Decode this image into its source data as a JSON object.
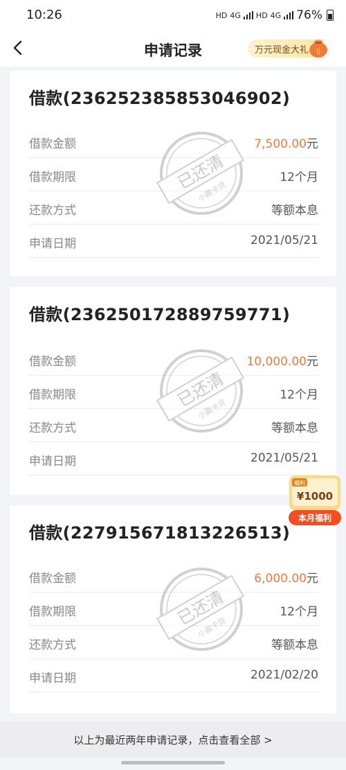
{
  "status": {
    "time": "10:26",
    "net1": "HD",
    "net2": "4G",
    "net3": "HD",
    "net4": "4G",
    "battery": "76%"
  },
  "nav": {
    "title": "申请记录",
    "promo_label": "万元现金大礼"
  },
  "stamp": {
    "text": "已还清",
    "sub": "小赢卡贷"
  },
  "cards": [
    {
      "title": "借款(2362523858530469​02)",
      "rows": [
        {
          "label": "借款金额",
          "amount": "7,500.00",
          "unit": "元"
        },
        {
          "label": "借款期限",
          "value": "12个月"
        },
        {
          "label": "还款方式",
          "value": "等额本息"
        },
        {
          "label": "申请日期",
          "value": "2021/05/21"
        }
      ]
    },
    {
      "title": "借款(236250172889759771)",
      "rows": [
        {
          "label": "借款金额",
          "amount": "10,000.00",
          "unit": "元"
        },
        {
          "label": "借款期限",
          "value": "12个月"
        },
        {
          "label": "还款方式",
          "value": "等额本息"
        },
        {
          "label": "申请日期",
          "value": "2021/05/21"
        }
      ]
    },
    {
      "title": "借款(227915671813226513)",
      "rows": [
        {
          "label": "借款金额",
          "amount": "6,000.00",
          "unit": "元"
        },
        {
          "label": "借款期限",
          "value": "12个月"
        },
        {
          "label": "还款方式",
          "value": "等额本息"
        },
        {
          "label": "申请日期",
          "value": "2021/02/20"
        }
      ]
    }
  ],
  "bonus": {
    "tag": "福利",
    "amount": "¥1000",
    "label": "本月福利"
  },
  "footer": {
    "text": "以上为最近两年申请记录，点击查看全部 >"
  },
  "colors": {
    "amount": "#ec7a43",
    "background": "#f3f4f8"
  }
}
